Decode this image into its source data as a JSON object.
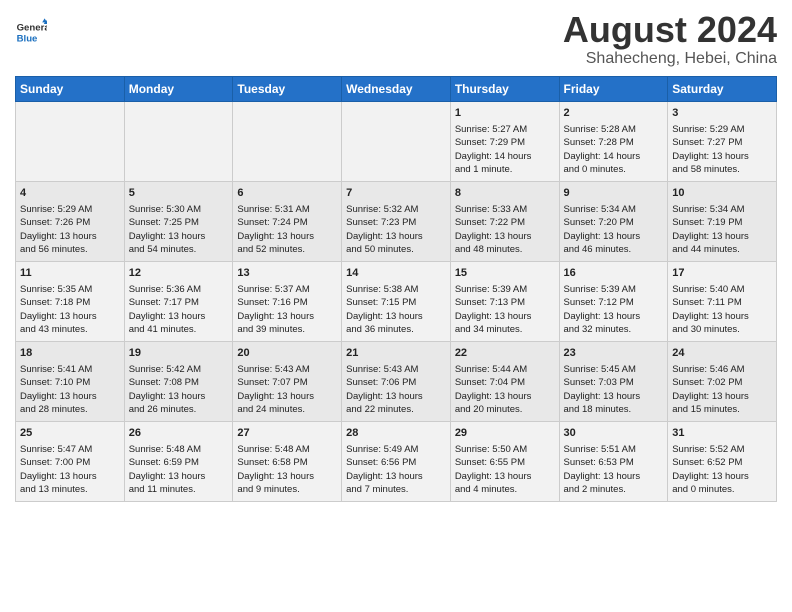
{
  "header": {
    "logo_text_general": "General",
    "logo_text_blue": "Blue",
    "title": "August 2024",
    "location": "Shahecheng, Hebei, China"
  },
  "weekdays": [
    "Sunday",
    "Monday",
    "Tuesday",
    "Wednesday",
    "Thursday",
    "Friday",
    "Saturday"
  ],
  "weeks": [
    [
      {
        "day": "",
        "info": ""
      },
      {
        "day": "",
        "info": ""
      },
      {
        "day": "",
        "info": ""
      },
      {
        "day": "",
        "info": ""
      },
      {
        "day": "1",
        "info": "Sunrise: 5:27 AM\nSunset: 7:29 PM\nDaylight: 14 hours\nand 1 minute."
      },
      {
        "day": "2",
        "info": "Sunrise: 5:28 AM\nSunset: 7:28 PM\nDaylight: 14 hours\nand 0 minutes."
      },
      {
        "day": "3",
        "info": "Sunrise: 5:29 AM\nSunset: 7:27 PM\nDaylight: 13 hours\nand 58 minutes."
      }
    ],
    [
      {
        "day": "4",
        "info": "Sunrise: 5:29 AM\nSunset: 7:26 PM\nDaylight: 13 hours\nand 56 minutes."
      },
      {
        "day": "5",
        "info": "Sunrise: 5:30 AM\nSunset: 7:25 PM\nDaylight: 13 hours\nand 54 minutes."
      },
      {
        "day": "6",
        "info": "Sunrise: 5:31 AM\nSunset: 7:24 PM\nDaylight: 13 hours\nand 52 minutes."
      },
      {
        "day": "7",
        "info": "Sunrise: 5:32 AM\nSunset: 7:23 PM\nDaylight: 13 hours\nand 50 minutes."
      },
      {
        "day": "8",
        "info": "Sunrise: 5:33 AM\nSunset: 7:22 PM\nDaylight: 13 hours\nand 48 minutes."
      },
      {
        "day": "9",
        "info": "Sunrise: 5:34 AM\nSunset: 7:20 PM\nDaylight: 13 hours\nand 46 minutes."
      },
      {
        "day": "10",
        "info": "Sunrise: 5:34 AM\nSunset: 7:19 PM\nDaylight: 13 hours\nand 44 minutes."
      }
    ],
    [
      {
        "day": "11",
        "info": "Sunrise: 5:35 AM\nSunset: 7:18 PM\nDaylight: 13 hours\nand 43 minutes."
      },
      {
        "day": "12",
        "info": "Sunrise: 5:36 AM\nSunset: 7:17 PM\nDaylight: 13 hours\nand 41 minutes."
      },
      {
        "day": "13",
        "info": "Sunrise: 5:37 AM\nSunset: 7:16 PM\nDaylight: 13 hours\nand 39 minutes."
      },
      {
        "day": "14",
        "info": "Sunrise: 5:38 AM\nSunset: 7:15 PM\nDaylight: 13 hours\nand 36 minutes."
      },
      {
        "day": "15",
        "info": "Sunrise: 5:39 AM\nSunset: 7:13 PM\nDaylight: 13 hours\nand 34 minutes."
      },
      {
        "day": "16",
        "info": "Sunrise: 5:39 AM\nSunset: 7:12 PM\nDaylight: 13 hours\nand 32 minutes."
      },
      {
        "day": "17",
        "info": "Sunrise: 5:40 AM\nSunset: 7:11 PM\nDaylight: 13 hours\nand 30 minutes."
      }
    ],
    [
      {
        "day": "18",
        "info": "Sunrise: 5:41 AM\nSunset: 7:10 PM\nDaylight: 13 hours\nand 28 minutes."
      },
      {
        "day": "19",
        "info": "Sunrise: 5:42 AM\nSunset: 7:08 PM\nDaylight: 13 hours\nand 26 minutes."
      },
      {
        "day": "20",
        "info": "Sunrise: 5:43 AM\nSunset: 7:07 PM\nDaylight: 13 hours\nand 24 minutes."
      },
      {
        "day": "21",
        "info": "Sunrise: 5:43 AM\nSunset: 7:06 PM\nDaylight: 13 hours\nand 22 minutes."
      },
      {
        "day": "22",
        "info": "Sunrise: 5:44 AM\nSunset: 7:04 PM\nDaylight: 13 hours\nand 20 minutes."
      },
      {
        "day": "23",
        "info": "Sunrise: 5:45 AM\nSunset: 7:03 PM\nDaylight: 13 hours\nand 18 minutes."
      },
      {
        "day": "24",
        "info": "Sunrise: 5:46 AM\nSunset: 7:02 PM\nDaylight: 13 hours\nand 15 minutes."
      }
    ],
    [
      {
        "day": "25",
        "info": "Sunrise: 5:47 AM\nSunset: 7:00 PM\nDaylight: 13 hours\nand 13 minutes."
      },
      {
        "day": "26",
        "info": "Sunrise: 5:48 AM\nSunset: 6:59 PM\nDaylight: 13 hours\nand 11 minutes."
      },
      {
        "day": "27",
        "info": "Sunrise: 5:48 AM\nSunset: 6:58 PM\nDaylight: 13 hours\nand 9 minutes."
      },
      {
        "day": "28",
        "info": "Sunrise: 5:49 AM\nSunset: 6:56 PM\nDaylight: 13 hours\nand 7 minutes."
      },
      {
        "day": "29",
        "info": "Sunrise: 5:50 AM\nSunset: 6:55 PM\nDaylight: 13 hours\nand 4 minutes."
      },
      {
        "day": "30",
        "info": "Sunrise: 5:51 AM\nSunset: 6:53 PM\nDaylight: 13 hours\nand 2 minutes."
      },
      {
        "day": "31",
        "info": "Sunrise: 5:52 AM\nSunset: 6:52 PM\nDaylight: 13 hours\nand 0 minutes."
      }
    ]
  ]
}
